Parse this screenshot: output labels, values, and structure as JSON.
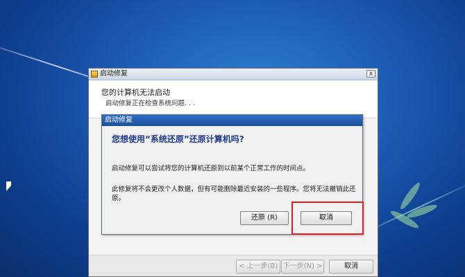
{
  "outer_window": {
    "title": "启动修复",
    "close_label": "x",
    "heading": "您的计算机无法启动",
    "status": "启动修复正在检查系统问题. . .",
    "footer": {
      "back_label": "< 上一步(B)",
      "next_label": "下一步(N) >",
      "cancel_label": "取消"
    }
  },
  "dialog": {
    "title": "启动修复",
    "question": "您想使用“系统还原”还原计算机吗?",
    "description": "启动修复可以尝试将您的计算机还原到以前某个正常工作的时间点。",
    "warning": "此修复将不会更改个人数据，但有可能删除最近安装的一些程序。您将无法撤销此还原。",
    "restore_label": "还原 (R)",
    "cancel_label": "取消"
  },
  "annotation": {
    "highlight_color": "#e02020"
  }
}
